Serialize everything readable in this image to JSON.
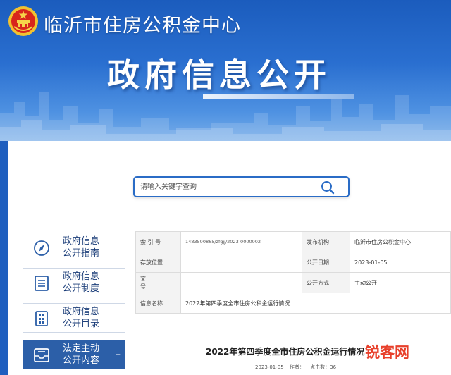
{
  "header": {
    "site_title": "临沂市住房公积金中心",
    "hero_title": "政府信息公开"
  },
  "search": {
    "placeholder": "请输入关键字查询"
  },
  "sidebar": {
    "items": [
      {
        "label_line1": "政府信息",
        "label_line2": "公开指南",
        "icon": "compass-icon"
      },
      {
        "label_line1": "政府信息",
        "label_line2": "公开制度",
        "icon": "document-list-icon"
      },
      {
        "label_line1": "政府信息",
        "label_line2": "公开目录",
        "icon": "grid-book-icon"
      },
      {
        "label_line1": "法定主动",
        "label_line2": "公开内容",
        "icon": "inbox-icon",
        "active": true,
        "indicator": "–"
      }
    ]
  },
  "info_table": {
    "rows": [
      {
        "k1": "索 引 号",
        "v1": "1483500865/zfgjj/2023-0000002",
        "k2": "发布机构",
        "v2": "临沂市住房公积金中心"
      },
      {
        "k1": "存放位置",
        "v1": "",
        "k2": "公开日期",
        "v2": "2023-01-05"
      },
      {
        "k1": "文 号",
        "v1": "",
        "k2": "公开方式",
        "v2": "主动公开"
      }
    ],
    "name_label": "信息名称",
    "name_value": "2022年第四季度全市住房公积金运行情况"
  },
  "article": {
    "title": "2022年第四季度全市住房公积金运行情况",
    "date": "2023-01-05",
    "author_label": "作者：",
    "views_label": "点击数：36"
  },
  "watermark": "锐客网",
  "colors": {
    "banner": "#1f5fbf",
    "accent_blue": "#2a6cc6",
    "active_sidebar": "#2c5fa8",
    "watermark": "#e8402b"
  }
}
